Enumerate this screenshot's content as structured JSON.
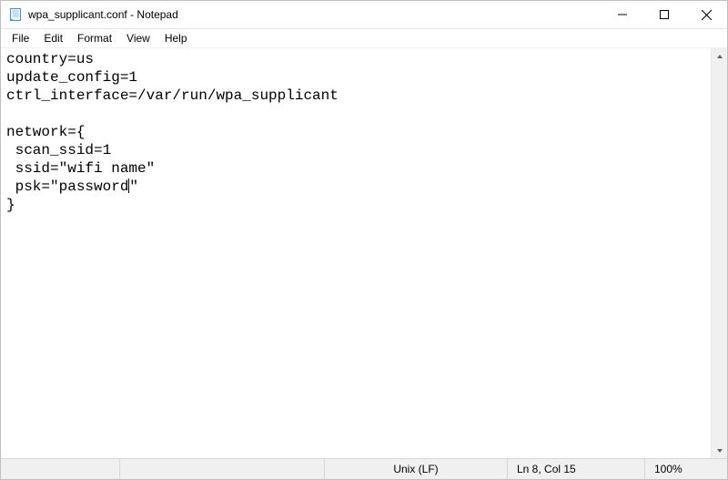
{
  "titlebar": {
    "title": "wpa_supplicant.conf - Notepad"
  },
  "menu": {
    "file": "File",
    "edit": "Edit",
    "format": "Format",
    "view": "View",
    "help": "Help"
  },
  "editor": {
    "line1": "country=us",
    "line2": "update_config=1",
    "line3": "ctrl_interface=/var/run/wpa_supplicant",
    "line4": "",
    "line5": "network={",
    "line6": " scan_ssid=1",
    "line7": " ssid=\"wifi name\"",
    "line8_before_caret": " psk=\"password",
    "line8_after_caret": "\"",
    "line9": "}"
  },
  "statusbar": {
    "line_ending": "Unix (LF)",
    "position": "Ln 8, Col 15",
    "zoom": "100%"
  }
}
